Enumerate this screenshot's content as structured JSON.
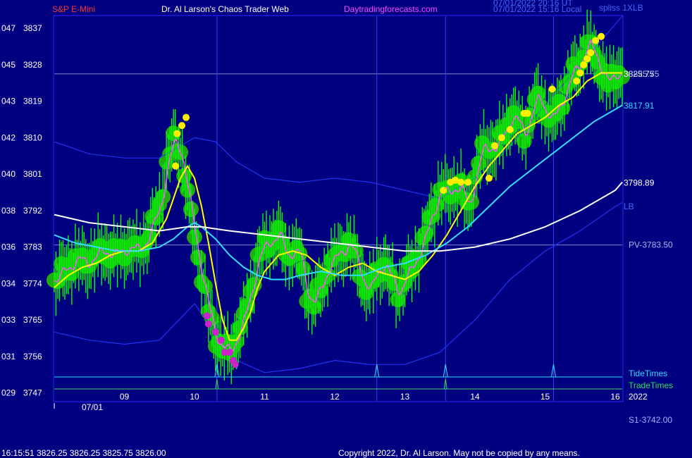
{
  "header": {
    "symbol": "S&P E-Mini",
    "title": "Dr. Al Larson's Chaos Trader Web",
    "site": "Daytradingforecasts.com",
    "utc_time": "07/01/2022 20:16 UT",
    "local_time": "07/01/2022 15:16 Local",
    "tag": "spliss 1XLB"
  },
  "footer": {
    "quote": "16:15:51  3826.25 3826.25 3825.75 3826.00",
    "copyright": "Copyright 2022, Dr. Al Larson. May not be copied by any means."
  },
  "colors": {
    "background": "#000080",
    "frame": "#2a2aff",
    "price_bars": "#00ff00",
    "halos": "#22aa11",
    "yellow_avg": "#ffff00",
    "magenta_avg": "#ff55ff",
    "cyan_avg": "#33ddff",
    "white_avg": "#ffffff",
    "bands": "#2233ee",
    "tide": "#33ddff",
    "trade": "#33dd55"
  },
  "chart_data": {
    "type": "line",
    "date_label": "07/01",
    "year_label": "2022",
    "x_ticks": [
      "09",
      "10",
      "11",
      "12",
      "13",
      "14",
      "15",
      "16"
    ],
    "y_ticks": [
      {
        "left": "047",
        "value": 3837
      },
      {
        "left": "045",
        "value": 3828
      },
      {
        "left": "043",
        "value": 3819
      },
      {
        "left": "042",
        "value": 3810
      },
      {
        "left": "040",
        "value": 3801
      },
      {
        "left": "038",
        "value": 3792
      },
      {
        "left": "036",
        "value": 3783
      },
      {
        "left": "034",
        "value": 3774
      },
      {
        "left": "033",
        "value": 3765
      },
      {
        "left": "031",
        "value": 3756
      },
      {
        "left": "029",
        "value": 3747
      }
    ],
    "xlim": [
      8.0,
      16.1
    ],
    "ylim": [
      3745,
      3840
    ],
    "vertical_lines": [
      10.32,
      12.6,
      13.58,
      15.12
    ],
    "horizontal_lines": [
      {
        "value": 3825.75,
        "label": "3825.75"
      },
      {
        "value": 3783.5,
        "label": "PV-3783.50"
      }
    ],
    "series_labels": [
      {
        "label": "3825.75",
        "value": 3825.75
      },
      {
        "label": "3817.91",
        "value": 3817.91
      },
      {
        "label": "3798.89",
        "value": 3798.89
      },
      {
        "label": "LB",
        "value": 3793
      }
    ],
    "s1_label": "S1-3742.00",
    "tide_label": "TideTimes",
    "trade_label": "TradeTimes",
    "tide_spikes": [
      10.32,
      12.6,
      13.58,
      15.12
    ],
    "trade_spikes": [
      10.32,
      13.58
    ],
    "price": {
      "x": [
        8.0,
        8.15,
        8.3,
        8.45,
        8.6,
        8.75,
        8.9,
        9.05,
        9.2,
        9.35,
        9.5,
        9.6,
        9.7,
        9.8,
        9.9,
        10.0,
        10.1,
        10.2,
        10.3,
        10.4,
        10.5,
        10.6,
        10.7,
        10.8,
        10.9,
        11.0,
        11.1,
        11.2,
        11.3,
        11.4,
        11.5,
        11.6,
        11.7,
        11.8,
        11.9,
        12.0,
        12.1,
        12.2,
        12.3,
        12.4,
        12.5,
        12.6,
        12.7,
        12.8,
        12.9,
        13.0,
        13.1,
        13.2,
        13.3,
        13.4,
        13.5,
        13.6,
        13.7,
        13.8,
        13.9,
        14.0,
        14.1,
        14.2,
        14.3,
        14.4,
        14.5,
        14.6,
        14.7,
        14.8,
        14.9,
        15.0,
        15.1,
        15.2,
        15.3,
        15.4,
        15.5,
        15.6,
        15.7,
        15.8,
        15.9,
        16.0,
        16.1
      ],
      "y": [
        3775,
        3777,
        3780,
        3779,
        3781,
        3782,
        3781,
        3783,
        3782,
        3786,
        3793,
        3803,
        3809,
        3807,
        3796,
        3786,
        3776,
        3767,
        3761,
        3758,
        3757,
        3761,
        3765,
        3772,
        3780,
        3783,
        3785,
        3786,
        3781,
        3782,
        3781,
        3772,
        3769,
        3773,
        3778,
        3780,
        3782,
        3784,
        3780,
        3775,
        3772,
        3777,
        3779,
        3775,
        3772,
        3775,
        3778,
        3782,
        3786,
        3792,
        3797,
        3796,
        3798,
        3797,
        3793,
        3800,
        3807,
        3808,
        3807,
        3811,
        3815,
        3814,
        3811,
        3816,
        3820,
        3817,
        3814,
        3818,
        3822,
        3826,
        3829,
        3833,
        3831,
        3827,
        3823,
        3826,
        3826
      ]
    },
    "series": [
      {
        "x": [
          8.0,
          8.2,
          8.4,
          8.6,
          8.8,
          9.0,
          9.2,
          9.4,
          9.6,
          9.8,
          9.9,
          10.0,
          10.1,
          10.2,
          10.3,
          10.4,
          10.5,
          10.6,
          10.7,
          10.8,
          10.9,
          11.0,
          11.2,
          11.4,
          11.6,
          11.8,
          12.0,
          12.2,
          12.4,
          12.6,
          12.8,
          13.0,
          13.2,
          13.4,
          13.6,
          13.8,
          14.0,
          14.2,
          14.4,
          14.6,
          14.8,
          15.0,
          15.2,
          15.4,
          15.6,
          15.8,
          16.0,
          16.1
        ],
        "y": [
          3773,
          3776,
          3778,
          3779,
          3781,
          3782,
          3782,
          3784,
          3790,
          3800,
          3803,
          3800,
          3793,
          3784,
          3774,
          3765,
          3760,
          3760,
          3763,
          3767,
          3773,
          3777,
          3781,
          3782,
          3781,
          3778,
          3776,
          3778,
          3779,
          3777,
          3776,
          3775,
          3777,
          3781,
          3786,
          3792,
          3798,
          3803,
          3807,
          3811,
          3813,
          3815,
          3818,
          3820,
          3824,
          3826,
          3826,
          3826
        ]
      },
      {
        "x": [
          8.0,
          8.3,
          8.6,
          8.9,
          9.2,
          9.5,
          9.7,
          9.9,
          10.0,
          10.1,
          10.3,
          10.5,
          10.7,
          10.9,
          11.1,
          11.3,
          11.5,
          11.8,
          12.1,
          12.4,
          12.7,
          13.0,
          13.3,
          13.6,
          13.9,
          14.2,
          14.5,
          14.8,
          15.1,
          15.4,
          15.7,
          16.0,
          16.1
        ],
        "y": [
          3786,
          3784,
          3783,
          3782,
          3782,
          3783,
          3785,
          3788,
          3789,
          3788,
          3785,
          3781,
          3778,
          3776,
          3775,
          3775,
          3776,
          3777,
          3776,
          3776,
          3778,
          3779,
          3781,
          3784,
          3788,
          3793,
          3798,
          3802,
          3806,
          3810,
          3814,
          3817,
          3818
        ]
      },
      {
        "x": [
          8.0,
          8.5,
          9.0,
          9.5,
          9.9,
          10.1,
          10.5,
          11.0,
          11.5,
          12.0,
          12.5,
          13.0,
          13.5,
          14.0,
          14.5,
          15.0,
          15.5,
          16.0,
          16.1
        ],
        "y": [
          3791,
          3789,
          3788,
          3787,
          3788,
          3788,
          3787,
          3786,
          3785,
          3784,
          3783,
          3782,
          3782,
          3783,
          3785,
          3788,
          3792,
          3797,
          3799
        ]
      },
      {
        "x": [
          8.0,
          8.5,
          9.0,
          9.5,
          10.0,
          10.3,
          10.6,
          11.0,
          11.5,
          12.0,
          12.5,
          13.0,
          13.5,
          14.0,
          14.5,
          15.0,
          15.5,
          16.0,
          16.1
        ],
        "y": [
          3809,
          3806,
          3805,
          3805,
          3810,
          3809,
          3804,
          3800,
          3799,
          3800,
          3799,
          3797,
          3795,
          3800,
          3808,
          3818,
          3828,
          3838,
          3840
        ]
      },
      {
        "x": [
          8.0,
          8.5,
          9.0,
          9.5,
          10.0,
          10.3,
          10.6,
          11.0,
          11.5,
          12.0,
          12.5,
          13.0,
          13.5,
          14.0,
          14.5,
          15.0,
          15.5,
          16.0,
          16.1
        ],
        "y": [
          3762,
          3760,
          3759,
          3760,
          3769,
          3762,
          3755,
          3752,
          3753,
          3755,
          3754,
          3754,
          3757,
          3765,
          3775,
          3782,
          3787,
          3793,
          3794
        ]
      }
    ],
    "dots": {
      "yellow": [
        [
          9.75,
          3811
        ],
        [
          9.82,
          3813
        ],
        [
          9.88,
          3815
        ],
        [
          9.73,
          3803
        ],
        [
          13.55,
          3797
        ],
        [
          13.65,
          3799
        ],
        [
          13.72,
          3799.5
        ],
        [
          13.8,
          3799
        ],
        [
          13.9,
          3799
        ],
        [
          14.2,
          3800
        ],
        [
          14.28,
          3808
        ],
        [
          14.38,
          3810
        ],
        [
          14.5,
          3812
        ],
        [
          14.7,
          3816
        ],
        [
          14.75,
          3816
        ],
        [
          15.1,
          3822
        ],
        [
          15.45,
          3824
        ],
        [
          15.5,
          3826
        ],
        [
          15.55,
          3828
        ],
        [
          15.6,
          3829.5
        ],
        [
          15.65,
          3831
        ],
        [
          15.72,
          3834
        ],
        [
          15.8,
          3835
        ]
      ],
      "magenta": [
        [
          10.18,
          3766
        ],
        [
          10.2,
          3764
        ],
        [
          10.3,
          3762
        ],
        [
          10.38,
          3760
        ],
        [
          10.43,
          3757
        ],
        [
          10.5,
          3757
        ],
        [
          10.55,
          3755
        ],
        [
          10.58,
          3754
        ]
      ]
    }
  }
}
